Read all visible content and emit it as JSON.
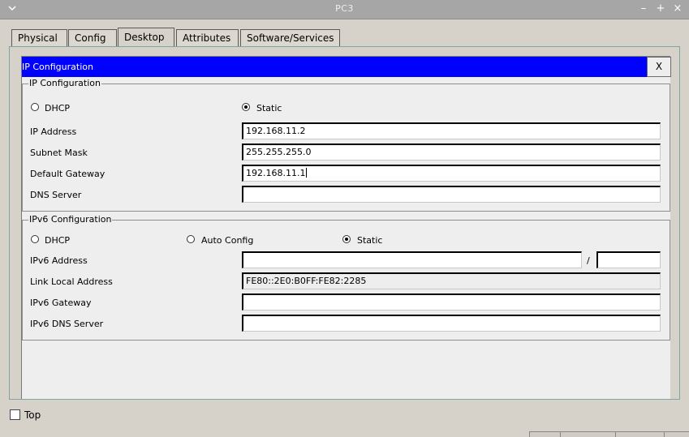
{
  "window": {
    "title": "PC3",
    "menu_icon": "chevron-down-icon",
    "buttons": {
      "minimize": "–",
      "restore": "+",
      "close": "×"
    }
  },
  "tabs": [
    {
      "label": "Physical",
      "active": false
    },
    {
      "label": "Config",
      "active": false
    },
    {
      "label": "Desktop",
      "active": true
    },
    {
      "label": "Attributes",
      "active": false
    },
    {
      "label": "Software/Services",
      "active": false
    }
  ],
  "app": {
    "title": "IP Configuration",
    "close_label": "X",
    "header_color": "#0000ff"
  },
  "ipv4": {
    "legend": "IP Configuration",
    "dhcp_label": "DHCP",
    "static_label": "Static",
    "mode": "Static",
    "ip_label": "IP Address",
    "ip_value": "192.168.11.2",
    "mask_label": "Subnet Mask",
    "mask_value": "255.255.255.0",
    "gateway_label": "Default Gateway",
    "gateway_value": "192.168.11.1",
    "dns_label": "DNS Server",
    "dns_value": ""
  },
  "ipv6": {
    "legend": "IPv6 Configuration",
    "dhcp_label": "DHCP",
    "auto_label": "Auto Config",
    "static_label": "Static",
    "mode": "Static",
    "address_label": "IPv6 Address",
    "address_value": "",
    "prefix_separator": "/",
    "prefix_value": "",
    "link_local_label": "Link Local Address",
    "link_local_value": "FE80::2E0:B0FF:FE82:2285",
    "gateway_label": "IPv6 Gateway",
    "gateway_value": "",
    "dns_label": "IPv6 DNS Server",
    "dns_value": ""
  },
  "footer": {
    "top_label": "Top",
    "top_checked": false
  }
}
